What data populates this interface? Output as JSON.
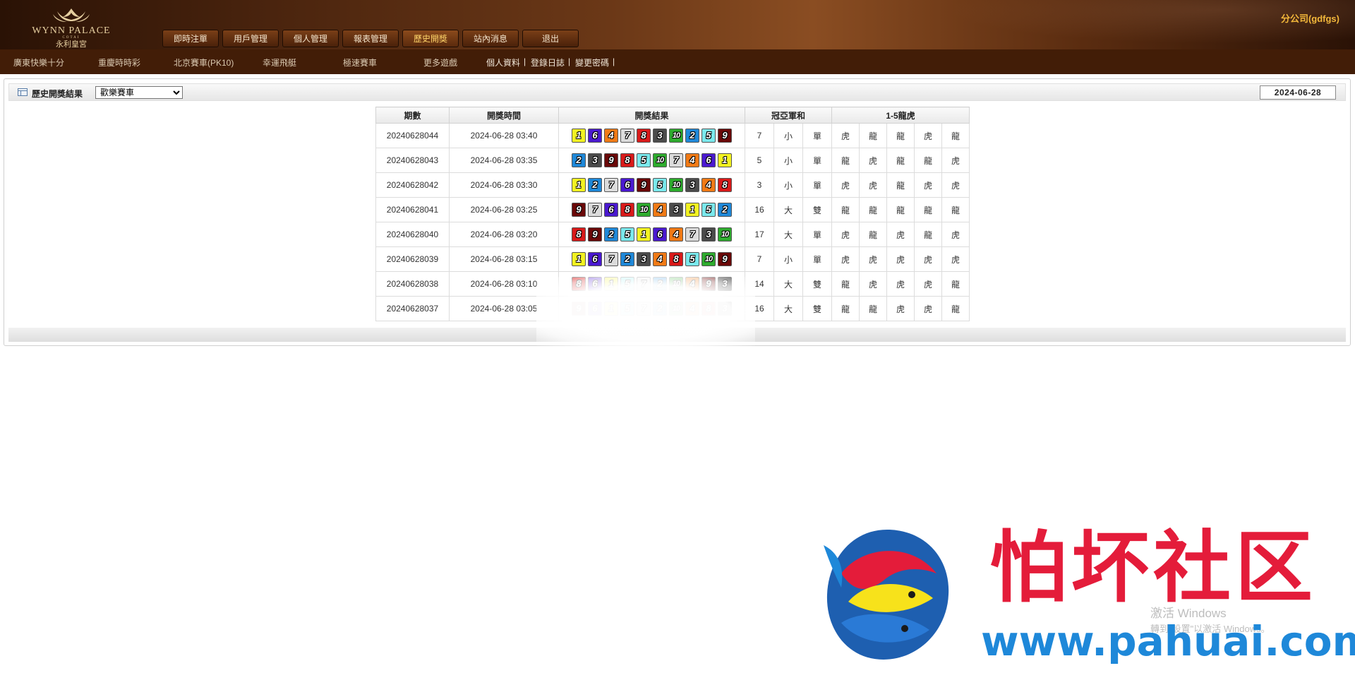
{
  "colors": {
    "header_brown": "#5a2c10",
    "active_tab": "#ffd56a",
    "company_text": "#f3b83a",
    "accent_red": "#c00000",
    "watermark_red": "#e41c3a",
    "watermark_blue": "#1e88d9"
  },
  "ball_colors": {
    "1": "#f2f221",
    "2": "#1f88d8",
    "3": "#4b4b4b",
    "4": "#f07a16",
    "5": "#7ae8ec",
    "6": "#4a19cf",
    "7": "#dcdcdc",
    "8": "#d81a1a",
    "9": "#6a0808",
    "10": "#2eab2e"
  },
  "header": {
    "logo": {
      "line1": "WYNN PALACE",
      "line2": "COTAI",
      "line3": "永利皇宮"
    },
    "nav": [
      "即時注單",
      "用戶管理",
      "個人管理",
      "報表管理",
      "歷史開獎",
      "站內消息",
      "退出"
    ],
    "active_nav": 4,
    "company": "分公司(gdfgs)"
  },
  "subnav": {
    "games": [
      "廣東快樂十分",
      "重慶時時彩",
      "北京賽車(PK10)",
      "幸運飛艇",
      "極速賽車",
      "更多遊戲"
    ],
    "account_links": [
      "個人資料",
      "登錄日誌",
      "變更密碼"
    ]
  },
  "panel": {
    "title": "歷史開獎結果",
    "game_select": {
      "value": "歡樂賽車",
      "options": [
        "歡樂賽車"
      ]
    },
    "date": "2024-06-28"
  },
  "table": {
    "headers": [
      "期數",
      "開獎時間",
      "開獎結果",
      "冠亞軍和",
      "1-5龍虎"
    ],
    "rows": [
      {
        "issue": "20240628044",
        "time": "2024-06-28 03:40",
        "balls": [
          1,
          6,
          4,
          7,
          8,
          3,
          10,
          2,
          5,
          9
        ],
        "sum": "7",
        "bs": "小",
        "oe": "單",
        "dt": [
          "虎",
          "龍",
          "龍",
          "虎",
          "龍"
        ]
      },
      {
        "issue": "20240628043",
        "time": "2024-06-28 03:35",
        "balls": [
          2,
          3,
          9,
          8,
          5,
          10,
          7,
          4,
          6,
          1
        ],
        "sum": "5",
        "bs": "小",
        "oe": "單",
        "dt": [
          "龍",
          "虎",
          "龍",
          "龍",
          "虎"
        ]
      },
      {
        "issue": "20240628042",
        "time": "2024-06-28 03:30",
        "balls": [
          1,
          2,
          7,
          6,
          9,
          5,
          10,
          3,
          4,
          8
        ],
        "sum": "3",
        "bs": "小",
        "oe": "單",
        "dt": [
          "虎",
          "虎",
          "龍",
          "虎",
          "虎"
        ]
      },
      {
        "issue": "20240628041",
        "time": "2024-06-28 03:25",
        "balls": [
          9,
          7,
          6,
          8,
          10,
          4,
          3,
          1,
          5,
          2
        ],
        "sum": "16",
        "bs": "大",
        "oe": "雙",
        "dt": [
          "龍",
          "龍",
          "龍",
          "龍",
          "龍"
        ]
      },
      {
        "issue": "20240628040",
        "time": "2024-06-28 03:20",
        "balls": [
          8,
          9,
          2,
          5,
          1,
          6,
          4,
          7,
          3,
          10
        ],
        "sum": "17",
        "bs": "大",
        "oe": "單",
        "dt": [
          "虎",
          "龍",
          "虎",
          "龍",
          "虎"
        ]
      },
      {
        "issue": "20240628039",
        "time": "2024-06-28 03:15",
        "balls": [
          1,
          6,
          7,
          2,
          3,
          4,
          8,
          5,
          10,
          9
        ],
        "sum": "7",
        "bs": "小",
        "oe": "單",
        "dt": [
          "虎",
          "虎",
          "虎",
          "虎",
          "虎"
        ]
      },
      {
        "issue": "20240628038",
        "time": "2024-06-28 03:10",
        "balls": [
          8,
          6,
          1,
          5,
          7,
          2,
          10,
          4,
          9,
          3
        ],
        "sum": "14",
        "bs": "大",
        "oe": "雙",
        "dt": [
          "龍",
          "虎",
          "虎",
          "虎",
          "龍"
        ]
      },
      {
        "issue": "20240628037",
        "time": "2024-06-28 03:05",
        "balls": [
          9,
          6,
          1,
          5,
          7,
          2,
          10,
          4,
          8,
          3
        ],
        "sum": "16",
        "bs": "大",
        "oe": "雙",
        "dt": [
          "龍",
          "龍",
          "虎",
          "虎",
          "龍"
        ]
      }
    ]
  },
  "windows_activation": {
    "title": "激活 Windows",
    "subtitle": "轉到\"設置\"以激活 Windows。"
  },
  "watermark": {
    "text": "怕坏社区",
    "url": "www.pahuai.com"
  }
}
